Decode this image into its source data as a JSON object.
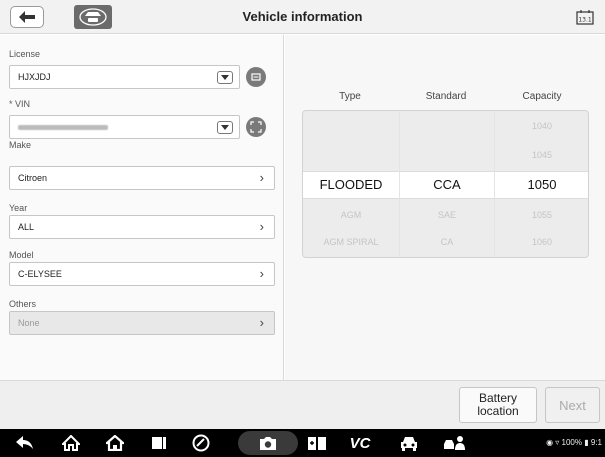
{
  "header": {
    "title": "Vehicle information",
    "vin_badge": "VIN",
    "version_badge": "13.1"
  },
  "form": {
    "license": {
      "label": "License",
      "value": "HJXJDJ"
    },
    "vin": {
      "label": "* VIN",
      "value": ""
    },
    "make": {
      "label": "Make",
      "value": "Citroen"
    },
    "year": {
      "label": "Year",
      "value": "ALL"
    },
    "model": {
      "label": "Model",
      "value": "C-ELYSEE"
    },
    "others": {
      "label": "Others",
      "value": "None"
    }
  },
  "battery_table": {
    "headers": [
      "Type",
      "Standard",
      "Capacity"
    ],
    "rows": [
      {
        "type": "",
        "standard": "",
        "capacity": "1040"
      },
      {
        "type": "",
        "standard": "",
        "capacity": "1045"
      },
      {
        "type": "FLOODED",
        "standard": "CCA",
        "capacity": "1050",
        "selected": true
      },
      {
        "type": "AGM",
        "standard": "SAE",
        "capacity": "1055"
      },
      {
        "type": "AGM SPIRAL",
        "standard": "CA",
        "capacity": "1060"
      }
    ]
  },
  "actions": {
    "battery_location": "Battery location",
    "next": "Next"
  },
  "navbar": {
    "vc_label": "VC",
    "status_text": "100%",
    "time_partial": "9:1"
  },
  "colors": {
    "header_bg": "#f2f2f2",
    "icon_grey": "#7a7a7a",
    "navbar_bg": "#000000"
  }
}
